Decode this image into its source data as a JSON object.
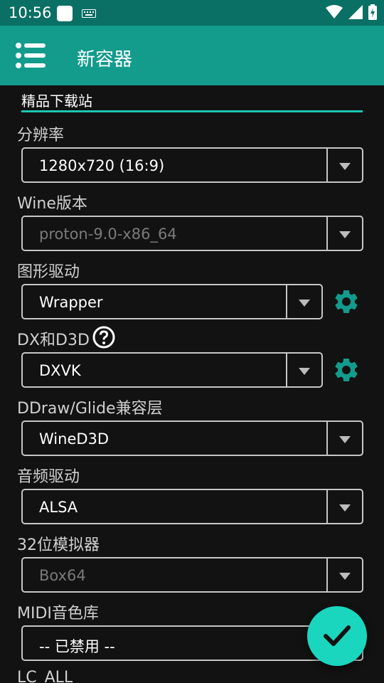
{
  "status_bar": {
    "time": "10:56"
  },
  "app_bar": {
    "title": "新容器"
  },
  "form": {
    "name_value": "精品下载站",
    "resolution": {
      "label": "分辨率",
      "value": "1280x720 (16:9)"
    },
    "wine": {
      "label": "Wine版本",
      "value": "proton-9.0-x86_64"
    },
    "graphics": {
      "label": "图形驱动",
      "value": "Wrapper"
    },
    "dx": {
      "label": "DX和D3D",
      "value": "DXVK"
    },
    "ddraw": {
      "label": "DDraw/Glide兼容层",
      "value": "WineD3D"
    },
    "audio": {
      "label": "音频驱动",
      "value": "ALSA"
    },
    "emulator": {
      "label": "32位模拟器",
      "value": "Box64"
    },
    "midi": {
      "label": "MIDI音色库",
      "value": "-- 已禁用 --"
    },
    "lc_all": {
      "label": "LC_ALL"
    }
  },
  "colors": {
    "status_bar": "#0a6f64",
    "app_bar": "#139b8c",
    "accent": "#1ac6b2",
    "fab": "#1ad6bf",
    "gear": "#139b8c"
  }
}
